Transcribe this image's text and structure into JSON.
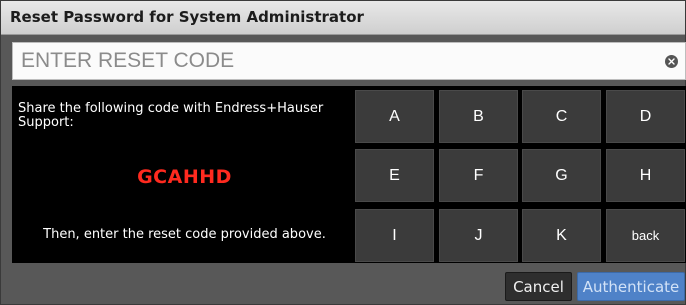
{
  "dialog": {
    "title": "Reset Password for System Administrator"
  },
  "reset_code_input": {
    "placeholder": "ENTER RESET CODE",
    "value": ""
  },
  "instructions": {
    "share_text": "Share the following code with Endress+Hauser Support:",
    "generated_code": "GCAHHD",
    "then_text": "Then, enter the reset code provided above."
  },
  "keypad": {
    "keys": [
      "A",
      "B",
      "C",
      "D",
      "E",
      "F",
      "G",
      "H",
      "I",
      "J",
      "K",
      "back"
    ]
  },
  "footer": {
    "cancel_label": "Cancel",
    "authenticate_label": "Authenticate"
  },
  "colors": {
    "code_text": "#ff2a1f",
    "authenticate_button": "#4f82c8"
  },
  "icons": {
    "clear": "clear-icon"
  }
}
